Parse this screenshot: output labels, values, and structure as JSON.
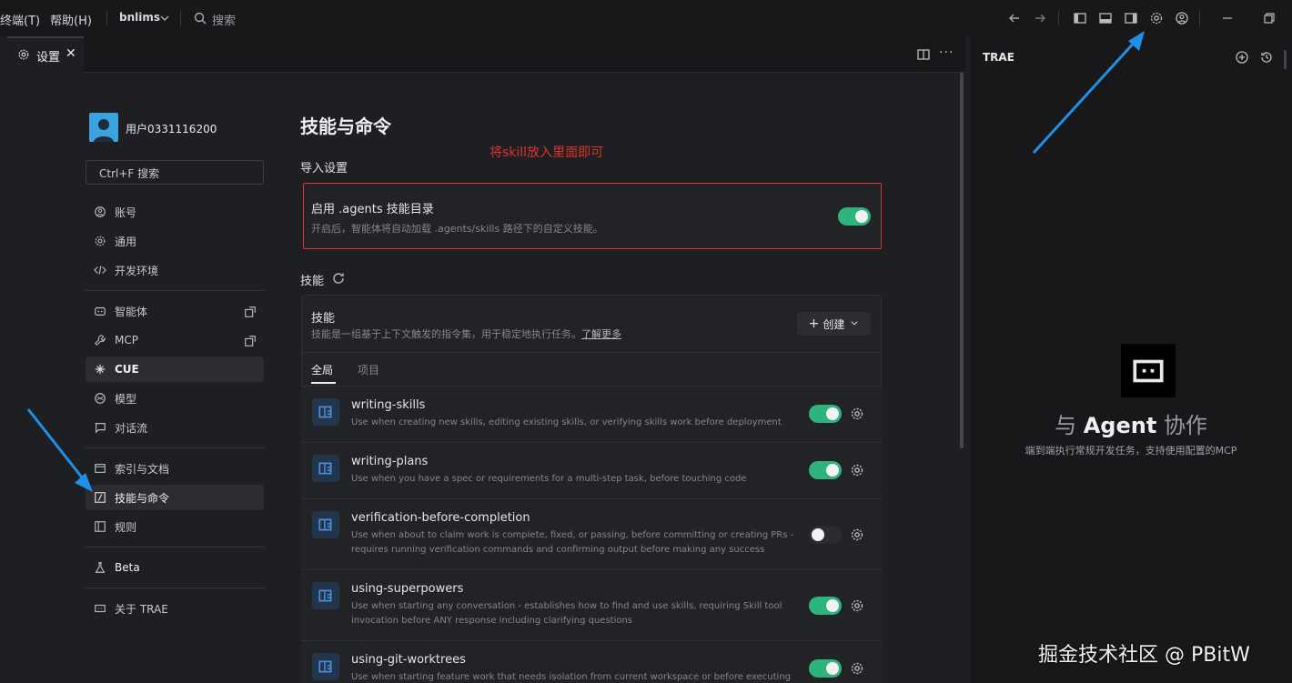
{
  "titlebar": {
    "menu_terminal": "终端(T)",
    "menu_help": "帮助(H)",
    "workspace": "bnlims",
    "search_placeholder": "搜索"
  },
  "tab": {
    "label": "设置"
  },
  "user": {
    "name": "用户0331116200"
  },
  "search": {
    "placeholder": "Ctrl+F 搜索"
  },
  "sidebar": {
    "items": [
      {
        "label": "账号"
      },
      {
        "label": "通用"
      },
      {
        "label": "开发环境"
      },
      {
        "label": "智能体"
      },
      {
        "label": "MCP"
      },
      {
        "label": "CUE"
      },
      {
        "label": "模型"
      },
      {
        "label": "对话流"
      },
      {
        "label": "索引与文档"
      },
      {
        "label": "技能与命令"
      },
      {
        "label": "规则"
      },
      {
        "label": "Beta"
      },
      {
        "label": "关于 TRAE"
      }
    ]
  },
  "main": {
    "title": "技能与命令",
    "annotation": "将skill放入里面即可",
    "import_section": "导入设置",
    "agents_dir": {
      "title": "启用 .agents 技能目录",
      "desc": "开启后，智能体将自动加载 .agents/skills 路径下的自定义技能。",
      "enabled": true
    },
    "skills_section": "技能",
    "skills_panel": {
      "title": "技能",
      "desc": "技能是一组基于上下文触发的指令集，用于稳定地执行任务。",
      "learn_more": "了解更多",
      "create_button": "创建",
      "tab_global": "全局",
      "tab_project": "项目"
    },
    "skills": [
      {
        "name": "writing-skills",
        "desc": "Use when creating new skills, editing existing skills, or verifying skills work before deployment",
        "enabled": true
      },
      {
        "name": "writing-plans",
        "desc": "Use when you have a spec or requirements for a multi-step task, before touching code",
        "enabled": true
      },
      {
        "name": "verification-before-completion",
        "desc": "Use when about to claim work is complete, fixed, or passing, before committing or creating PRs - requires running verification commands and confirming output before making any success claims; evid...",
        "enabled": false
      },
      {
        "name": "using-superpowers",
        "desc": "Use when starting any conversation - establishes how to find and use skills, requiring Skill tool invocation before ANY response including clarifying questions",
        "enabled": true
      },
      {
        "name": "using-git-worktrees",
        "desc": "Use when starting feature work that needs isolation from current workspace or before executing impl",
        "enabled": true
      }
    ]
  },
  "right_panel": {
    "title": "TRAE",
    "heading_prefix": "与",
    "heading_agent": "Agent",
    "heading_suffix": "协作",
    "subtitle": "端到端执行常规开发任务，支持使用配置的MCP"
  },
  "watermark": "掘金技术社区 @ PBitW",
  "colors": {
    "accent": "#2fb37c",
    "annotation": "#e0312f",
    "arrow": "#1e90e6"
  }
}
